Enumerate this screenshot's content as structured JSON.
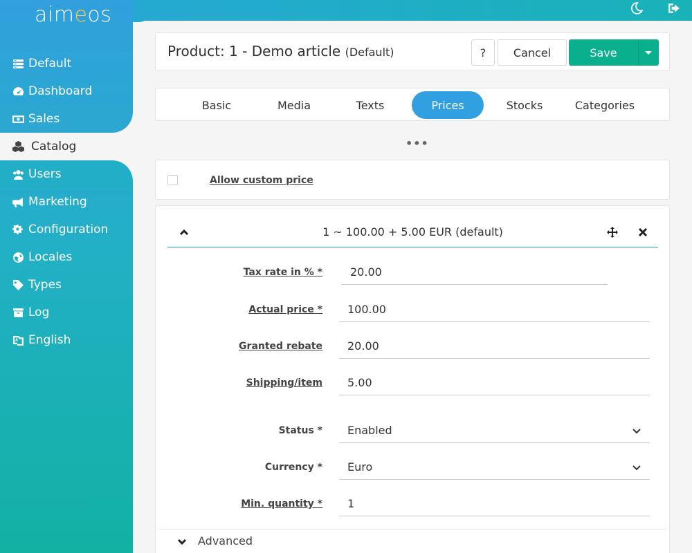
{
  "sidebar": {
    "logo": {
      "pre": "aim",
      "accent": "e",
      "post": "os"
    },
    "items": [
      {
        "label": "Default",
        "icon": "list-icon"
      },
      {
        "label": "Dashboard",
        "icon": "gauge-icon"
      },
      {
        "label": "Sales",
        "icon": "money-icon"
      },
      {
        "label": "Catalog",
        "icon": "cubes-icon",
        "active": true
      },
      {
        "label": "Users",
        "icon": "users-icon"
      },
      {
        "label": "Marketing",
        "icon": "megaphone-icon"
      },
      {
        "label": "Configuration",
        "icon": "gears-icon"
      },
      {
        "label": "Locales",
        "icon": "globe-icon"
      },
      {
        "label": "Types",
        "icon": "tag-icon"
      },
      {
        "label": "Log",
        "icon": "archive-icon"
      },
      {
        "label": "English",
        "icon": "language-icon"
      }
    ]
  },
  "topbar": {
    "icons": [
      "moon-icon",
      "logout-icon"
    ]
  },
  "header": {
    "title": "Product: 1 - Demo article",
    "subtitle": "(Default)",
    "help_label": "?",
    "cancel_label": "Cancel",
    "save_label": "Save"
  },
  "tabs": [
    "Basic",
    "Media",
    "Texts",
    "Prices",
    "Stocks",
    "Categories"
  ],
  "active_tab": "Prices",
  "more_dots": "•••",
  "custom_price": {
    "label": "Allow custom price",
    "checked": false
  },
  "price": {
    "summary": "1 ~ 100.00 + 5.00 EUR (default)",
    "fields": {
      "tax_label": "Tax rate in %",
      "tax_value": "20.00",
      "actual_label": "Actual price",
      "actual_value": "100.00",
      "rebate_label": "Granted rebate",
      "rebate_value": "20.00",
      "shipping_label": "Shipping/item",
      "shipping_value": "5.00",
      "status_label": "Status",
      "status_value": "Enabled",
      "currency_label": "Currency",
      "currency_value": "Euro",
      "minqty_label": "Min. quantity",
      "minqty_value": "1",
      "required_mark": "*"
    },
    "advanced_label": "Advanced"
  },
  "colors": {
    "accent": "#30a0e0",
    "save": "#0ab08e",
    "sidebar_top": "#31a0dd",
    "sidebar_bottom": "#12b1a3"
  }
}
